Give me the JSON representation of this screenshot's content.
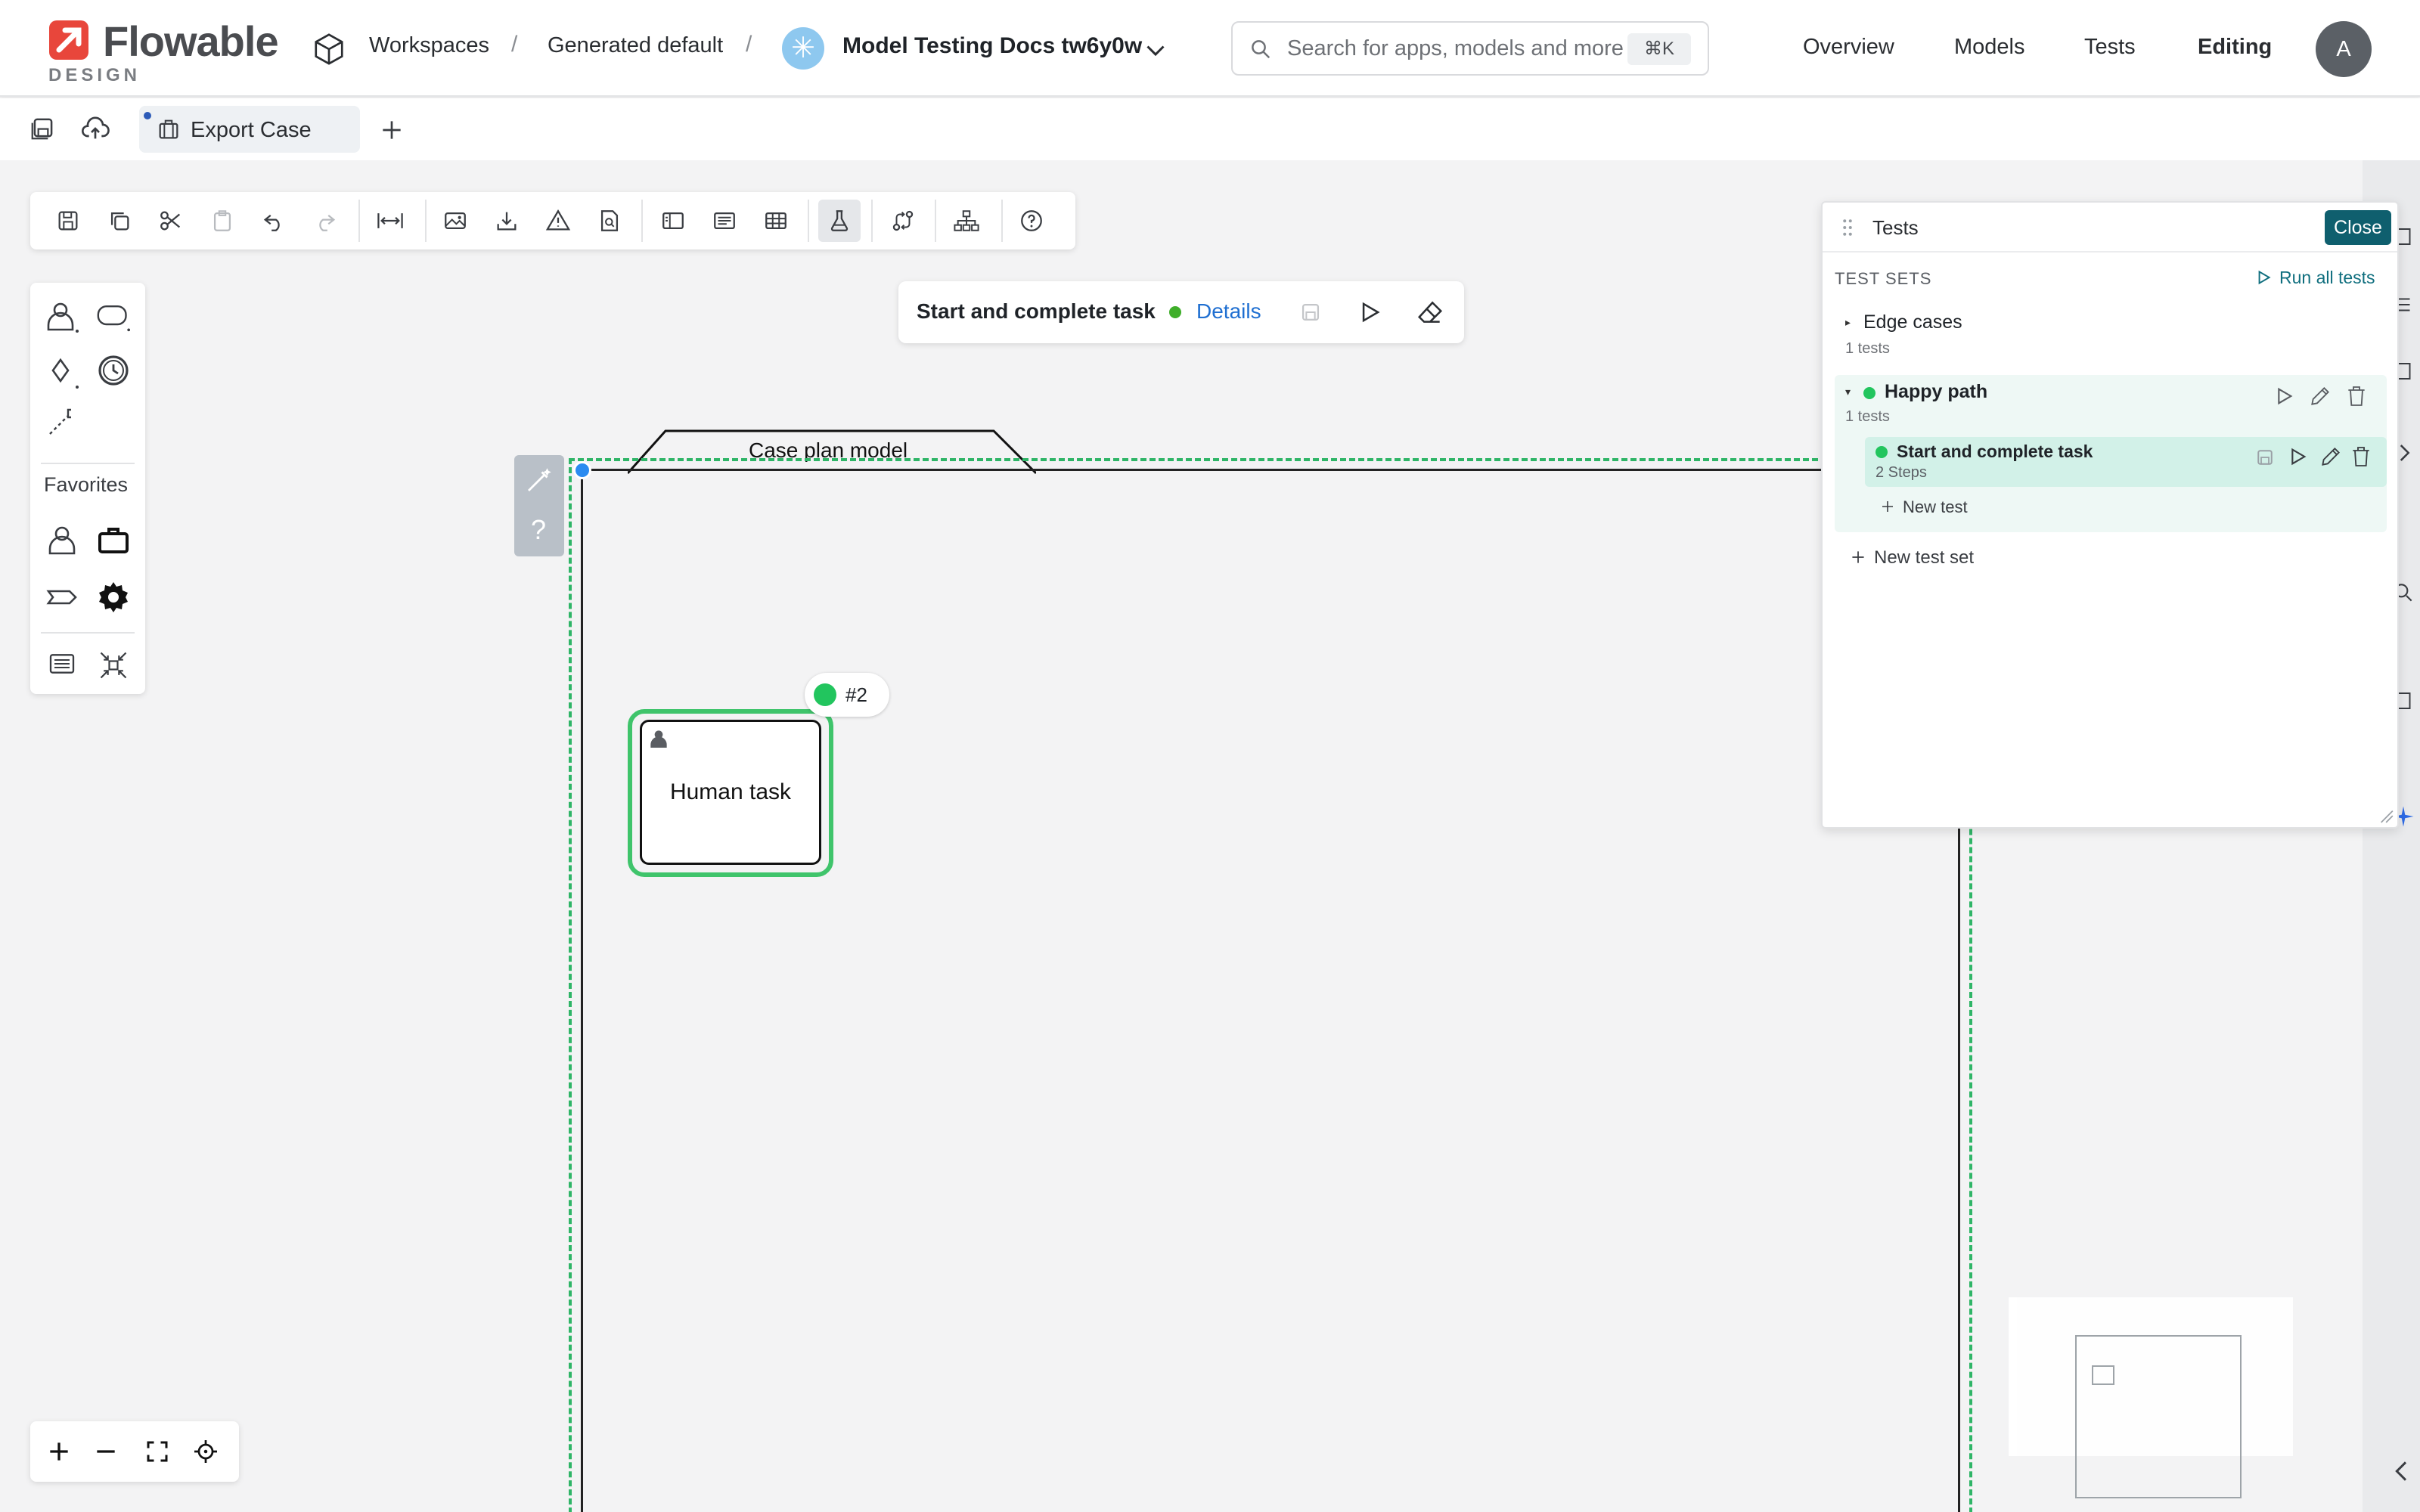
{
  "header": {
    "logo_word": "Flowable",
    "logo_sub": "DESIGN",
    "breadcrumb": {
      "workspaces": "Workspaces",
      "sep": "/",
      "workspace": "Generated default",
      "model": "Model Testing Docs tw6y0w"
    },
    "search": {
      "placeholder": "Search for apps, models and more",
      "shortcut": "⌘K"
    },
    "nav": {
      "overview": "Overview",
      "models": "Models",
      "tests": "Tests",
      "editing": "Editing"
    },
    "avatar_initial": "A"
  },
  "tabs": {
    "export_case": "Export Case"
  },
  "testbar": {
    "title": "Start and complete task",
    "details": "Details"
  },
  "palette": {
    "favorites": "Favorites"
  },
  "diagram": {
    "case_plan_model": "Case plan model",
    "human_task": "Human task",
    "badge": "#2"
  },
  "tests_panel": {
    "title": "Tests",
    "close": "Close",
    "sets_label": "TEST SETS",
    "run_all": "Run all tests",
    "sets": [
      {
        "name": "Edge cases",
        "count": "1 tests"
      },
      {
        "name": "Happy path",
        "count": "1 tests"
      }
    ],
    "test": {
      "name": "Start and complete task",
      "steps": "2 Steps"
    },
    "new_test": "New test",
    "new_test_set": "New test set"
  },
  "colors": {
    "accent": "#0f5f6e",
    "success": "#22c55e",
    "link": "#1f6fd1",
    "brand": "#e8463b"
  },
  "icons": [
    "save-icon",
    "copy-icon",
    "cut-icon",
    "paste-icon",
    "undo-icon",
    "redo-icon",
    "resize-icon",
    "image-icon",
    "download-icon",
    "warning-icon",
    "search-doc-icon",
    "panel-icon",
    "form-icon",
    "table-icon",
    "flask-icon",
    "flow-icon",
    "hierarchy-icon",
    "help-icon"
  ]
}
